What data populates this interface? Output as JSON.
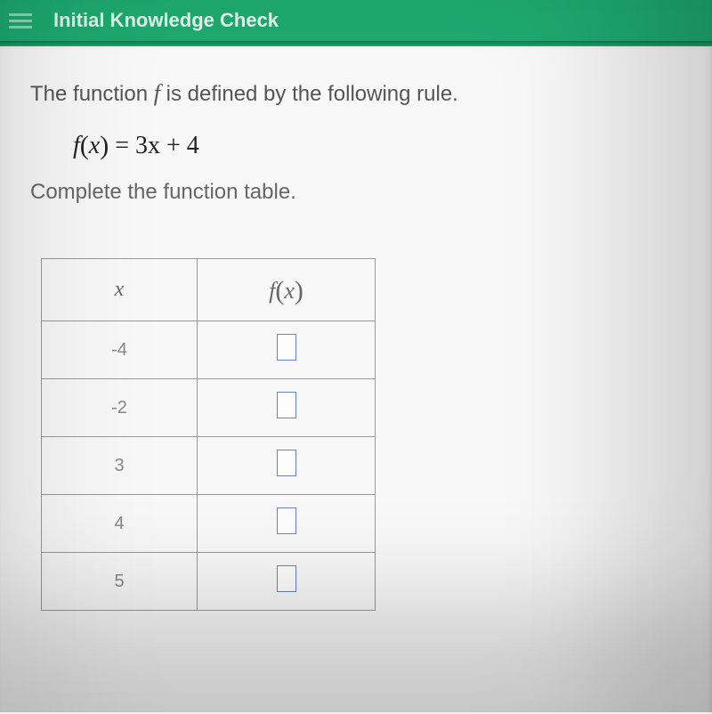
{
  "header": {
    "title": "Initial Knowledge Check"
  },
  "question": {
    "intro_pre": "The function ",
    "intro_fname": "f",
    "intro_post": " is defined by the following rule.",
    "equation_lhs": "f(x)",
    "equation_rhs": "3x + 4",
    "instruction": "Complete the function table."
  },
  "chart_data": {
    "type": "table",
    "columns": [
      "x",
      "f(x)"
    ],
    "rows": [
      {
        "x": "-4",
        "fx": ""
      },
      {
        "x": "-2",
        "fx": ""
      },
      {
        "x": "3",
        "fx": ""
      },
      {
        "x": "4",
        "fx": ""
      },
      {
        "x": "5",
        "fx": ""
      }
    ]
  }
}
